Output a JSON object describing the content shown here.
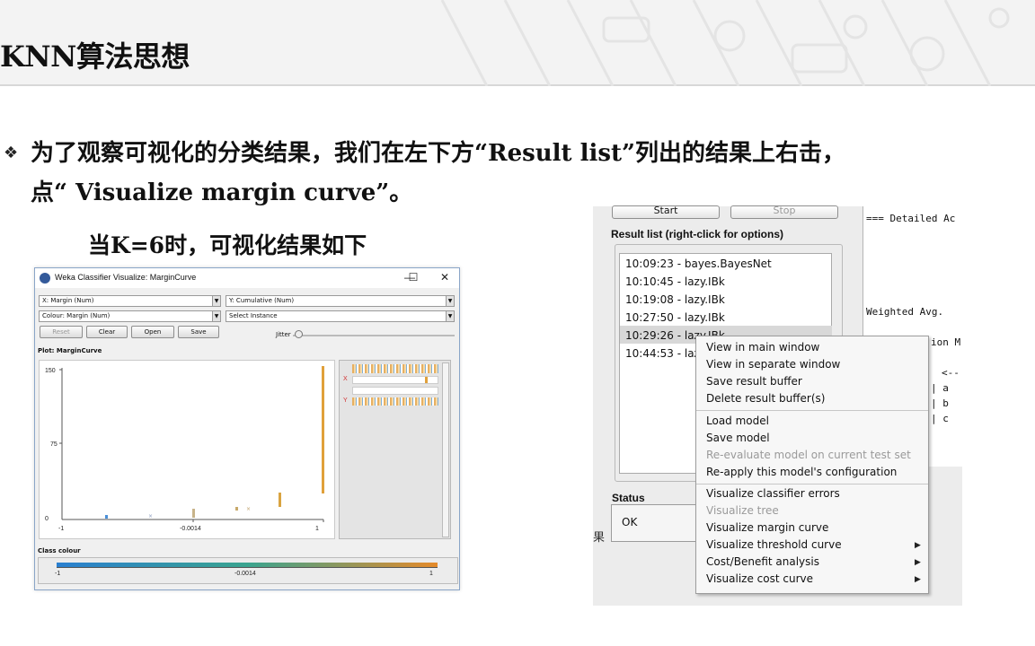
{
  "slide": {
    "title": "KNN算法思想",
    "bullet_symbol": "❖",
    "bullet_line1": "为了观察可视化的分类结果，我们在左下方“Result list”列出的结果上右击，",
    "bullet_line2": "点“ Visualize margin curve”。",
    "caption": "当K=6时，可视化结果如下"
  },
  "weka_window": {
    "title": "Weka Classifier Visualize: MarginCurve",
    "controls": {
      "minimize": "—",
      "maximize": "☐",
      "close": "✕"
    },
    "x_axis_select": "X: Margin (Num)",
    "y_axis_select": "Y: Cumulative (Num)",
    "colour_select": "Colour: Margin (Num)",
    "instance_select": "Select Instance",
    "buttons": {
      "reset": "Reset",
      "clear": "Clear",
      "open": "Open",
      "save": "Save"
    },
    "jitter_label": "Jitter",
    "plot_label": "Plot: MarginCurve",
    "y_ticks": [
      "150",
      "75",
      "0"
    ],
    "x_ticks": [
      "-1",
      "-0.0014",
      "1"
    ],
    "side_x": "X",
    "side_y": "Y",
    "class_colour_label": "Class colour",
    "colour_ticks": [
      "-1",
      "-0.0014",
      "1"
    ],
    "colors": {
      "gradient_start": "#2a7fd0",
      "gradient_mid": "#3aa48f",
      "gradient_end": "#e58a2a",
      "points": "#d9a441"
    }
  },
  "result_panel": {
    "start_label": "Start",
    "stop_label": "Stop",
    "result_list_title": "Result list (right-click for options)",
    "results": [
      "10:09:23 - bayes.BayesNet",
      "10:10:45 - lazy.IBk",
      "10:19:08 - lazy.IBk",
      "10:27:50 - lazy.IBk",
      "10:29:26 - lazy.IBk",
      "10:44:53 - lazy.IBk"
    ],
    "status_title": "Status",
    "status_value": "OK",
    "bottom_left_char": "果",
    "output_lines": [
      "=== Detailed Ac",
      "Weighted Avg.",
      "ion M",
      "<--",
      "|  a",
      "|  b",
      "|  c"
    ]
  },
  "context_menu": {
    "items": [
      {
        "label": "View in main window",
        "enabled": true
      },
      {
        "label": "View in separate window",
        "enabled": true
      },
      {
        "label": "Save result buffer",
        "enabled": true
      },
      {
        "label": "Delete result buffer(s)",
        "enabled": true
      },
      {
        "label": "Load model",
        "enabled": true
      },
      {
        "label": "Save model",
        "enabled": true
      },
      {
        "label": "Re-evaluate model on current test set",
        "enabled": false
      },
      {
        "label": "Re-apply this model's configuration",
        "enabled": true
      },
      {
        "label": "Visualize classifier errors",
        "enabled": true
      },
      {
        "label": "Visualize tree",
        "enabled": false
      },
      {
        "label": "Visualize margin curve",
        "enabled": true
      },
      {
        "label": "Visualize threshold curve",
        "enabled": true,
        "submenu": true
      },
      {
        "label": "Cost/Benefit analysis",
        "enabled": true,
        "submenu": true
      },
      {
        "label": "Visualize cost curve",
        "enabled": true,
        "submenu": true
      }
    ],
    "submenu_arrow": "▶"
  }
}
